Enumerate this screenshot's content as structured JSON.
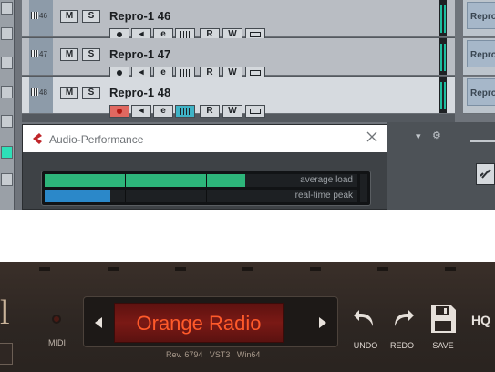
{
  "tracks": [
    {
      "num": "46",
      "name": "Repro-1 46",
      "m": "M",
      "s": "S",
      "r": "R",
      "w": "W",
      "e": "e",
      "selected": false
    },
    {
      "num": "47",
      "name": "Repro-1 47",
      "m": "M",
      "s": "S",
      "r": "R",
      "w": "W",
      "e": "e",
      "selected": false
    },
    {
      "num": "48",
      "name": "Repro-1 48",
      "m": "M",
      "s": "S",
      "r": "R",
      "w": "W",
      "e": "e",
      "selected": true
    }
  ],
  "lane_events": [
    "Repro",
    "Repro",
    "Repro"
  ],
  "audio_performance": {
    "title": "Audio-Performance",
    "average_load_label": "average load",
    "realtime_peak_label": "real-time peak",
    "average_load": 0.64,
    "realtime_peak": 0.21,
    "colors": {
      "average": "#2db57a",
      "peak": "#2b88c9"
    }
  },
  "plugin": {
    "preset_name": "Orange Radio",
    "midi_label": "MIDI",
    "undo_label": "UNDO",
    "redo_label": "REDO",
    "save_label": "SAVE",
    "hq_label": "HQ",
    "version": {
      "rev": "Rev. 6794",
      "format": "VST3",
      "platform": "Win64"
    }
  }
}
